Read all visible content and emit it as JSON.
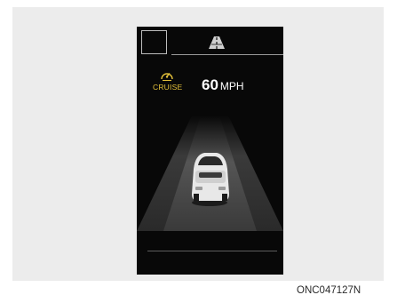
{
  "cluster": {
    "cruise_label": "CRUISE",
    "speed_value": "60",
    "speed_unit": "MPH",
    "icons": [
      "cruise-speedometer-icon",
      "lane-road-icon",
      "car-icon"
    ],
    "accent_color": "#e3c03a"
  },
  "caption": "ONC047127N"
}
